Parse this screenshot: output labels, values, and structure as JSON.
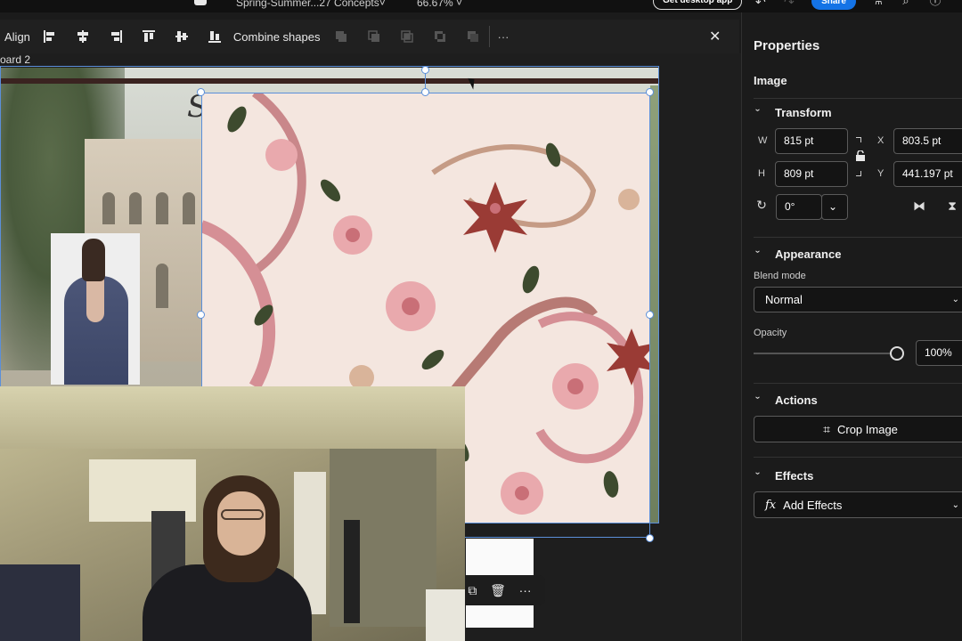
{
  "topbar": {
    "doc_title": "Spring-Summer...27 Concepts˅",
    "zoom": "66.67% ˅",
    "get_desktop_app": "Get desktop app",
    "share": "Share"
  },
  "toolbar": {
    "align_label": "Align",
    "combine_label": "Combine shapes",
    "more": "···",
    "close": "✕"
  },
  "canvas": {
    "artboard_label": "oard 2",
    "headline_fragment": "S"
  },
  "float_bar": {
    "duplicate": "⧉",
    "delete": "🗑",
    "more": "···"
  },
  "properties": {
    "title": "Properties",
    "selection_type": "Image",
    "transform": {
      "section_label": "Transform",
      "w_label": "W",
      "w_value": "815 pt",
      "h_label": "H",
      "h_value": "809 pt",
      "x_label": "X",
      "x_value": "803.5 pt",
      "y_label": "Y",
      "y_value": "441.197 pt",
      "rotation_value": "0°"
    },
    "appearance": {
      "section_label": "Appearance",
      "blend_label": "Blend mode",
      "blend_value": "Normal",
      "opacity_label": "Opacity",
      "opacity_value": "100%",
      "opacity_fraction": 1.0
    },
    "actions": {
      "section_label": "Actions",
      "crop_label": "Crop Image"
    },
    "effects": {
      "section_label": "Effects",
      "add_label": "Add Effects"
    }
  },
  "colors": {
    "accent": "#1473e6",
    "selection": "#5b8fd9",
    "panel_bg": "#1b1b1b"
  }
}
